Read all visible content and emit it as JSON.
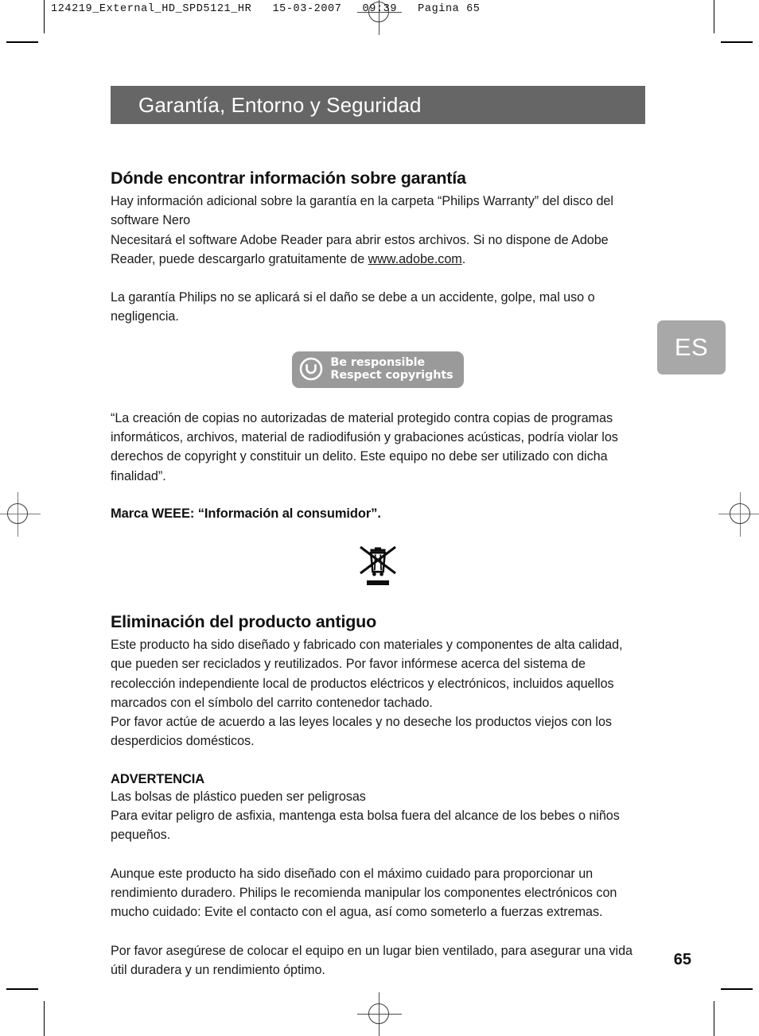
{
  "slug": {
    "text": "124219_External_HD_SPD5121_HR   15-03-2007   09:39   Pagina 65"
  },
  "chapter": {
    "title": "Garantía, Entorno y Seguridad"
  },
  "language_tab": {
    "label": "ES"
  },
  "sections": {
    "warranty": {
      "heading": "Dónde encontrar información sobre garantía",
      "para1": "Hay información adicional sobre la garantía en la carpeta “Philips Warranty” del disco del software Nero",
      "para2_before_link": "Necesitará el software Adobe Reader para abrir estos archivos. Si no dispone de Adobe Reader, puede descargarlo gratuitamente de ",
      "para2_link": "www.adobe.com",
      "para2_after_link": ".",
      "para3": "La garantía Philips no se aplicará si el daño se debe a un accidente, golpe, mal uso o negligencia."
    },
    "copyright_badge": {
      "icon": "copy-protection-icon",
      "line1": "Be responsible",
      "line2": "Respect copyrights"
    },
    "copyright_notice": {
      "text": "“La creación de copias no autorizadas de material protegido contra copias de programas informáticos, archivos, material de radiodifusión y grabaciones acústicas, podría violar los derechos de copyright y constituir un delito. Este equipo no debe ser utilizado con dicha finalidad”."
    },
    "weee": {
      "heading": "Marca WEEE: “Información al consumidor”.",
      "icon": "crossed-out-wheeled-bin-icon"
    },
    "disposal": {
      "heading": "Eliminación del producto antiguo",
      "para1": "Este producto ha sido diseñado y fabricado con materiales y componentes de alta calidad, que pueden ser reciclados y reutilizados. Por favor infórmese acerca del sistema de recolección independiente local de productos eléctricos y electrónicos, incluidos aquellos marcados con el símbolo del carrito contenedor tachado.",
      "para2": "Por favor actúe de acuerdo a las leyes locales y no deseche los productos viejos con los desperdicios domésticos."
    },
    "warning": {
      "heading": "ADVERTENCIA",
      "para1": "Las bolsas de plástico pueden ser peligrosas",
      "para2": "Para evitar peligro de asfixia, mantenga esta bolsa fuera del alcance de los bebes o niños pequeños.",
      "para3": "Aunque este producto ha sido diseñado con el máximo cuidado para proporcionar un rendimiento duradero. Philips le recomienda manipular los componentes electrónicos con mucho cuidado: Evite el contacto con el agua, así como someterlo a fuerzas extremas.",
      "para4": "Por favor asegúrese de colocar el equipo en un lugar bien ventilado, para asegurar una vida útil duradera y un rendimiento óptimo."
    }
  },
  "footer": {
    "page_number": "65"
  },
  "colors": {
    "chapter_bar": "#666666",
    "language_tab": "#a8a8a8",
    "badge_background": "#9a9a9a",
    "text": "#1a1a1a",
    "page_background": "#ffffff"
  }
}
